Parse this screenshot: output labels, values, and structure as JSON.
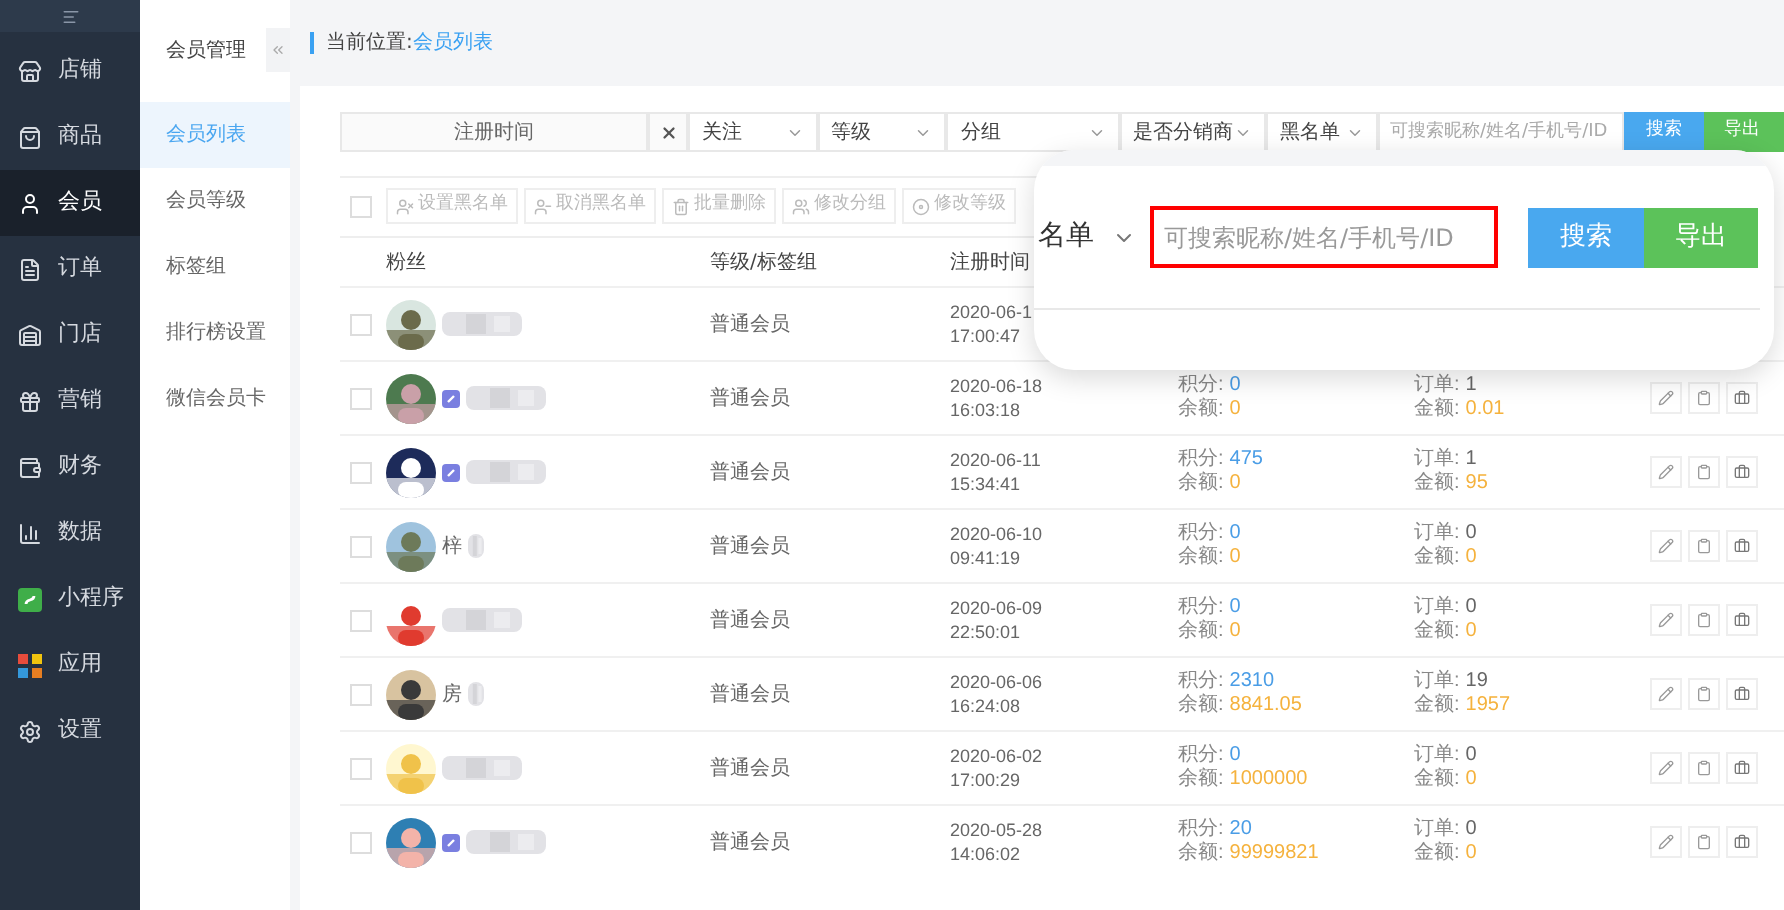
{
  "sidebar": {
    "items": [
      {
        "label": "店铺",
        "selected": false
      },
      {
        "label": "商品",
        "selected": false
      },
      {
        "label": "会员",
        "selected": true
      },
      {
        "label": "订单",
        "selected": false
      },
      {
        "label": "门店",
        "selected": false
      },
      {
        "label": "营销",
        "selected": false
      },
      {
        "label": "财务",
        "selected": false
      },
      {
        "label": "数据",
        "selected": false
      },
      {
        "label": "小程序",
        "selected": false
      },
      {
        "label": "应用",
        "selected": false
      },
      {
        "label": "设置",
        "selected": false
      }
    ]
  },
  "submenu": {
    "title": "会员管理",
    "items": [
      {
        "label": "会员列表",
        "selected": true
      },
      {
        "label": "会员等级",
        "selected": false
      },
      {
        "label": "标签组",
        "selected": false
      },
      {
        "label": "排行榜设置",
        "selected": false
      },
      {
        "label": "微信会员卡",
        "selected": false
      }
    ]
  },
  "breadcrumb": {
    "label": "当前位置:",
    "current": "会员列表"
  },
  "filters": [
    {
      "kind": "date",
      "placeholder": "注册时间"
    },
    {
      "kind": "clear"
    },
    {
      "kind": "select",
      "label": "关注"
    },
    {
      "kind": "select",
      "label": "等级"
    },
    {
      "kind": "select",
      "label": "分组"
    },
    {
      "kind": "select",
      "label": "是否分销商"
    },
    {
      "kind": "select",
      "label": "黑名单"
    },
    {
      "kind": "search",
      "placeholder": "可搜索昵称/姓名/手机号/ID"
    }
  ],
  "search_button": "搜索",
  "export_button": "导出",
  "select_all_checked": false,
  "bulk_actions": [
    "设置黑名单",
    "取消黑名单",
    "批量删除",
    "修改分组",
    "修改等级"
  ],
  "table": {
    "columns": [
      "粉丝",
      "等级/标签组",
      "注册时间"
    ],
    "rows": [
      {
        "checked": false,
        "linked": false,
        "blurred": true,
        "tier": "普通会员",
        "date": "2020-06-1",
        "time": "17:00:47"
      },
      {
        "checked": false,
        "linked": true,
        "blurred": true,
        "tier": "普通会员",
        "date": "2020-06-18",
        "time": "16:03:18",
        "points_label": "积分:",
        "points": "0",
        "balance_label": "余额:",
        "balance": "0",
        "orders_label": "订单:",
        "orders": "1",
        "amount_label": "金额:",
        "amount": "0.01"
      },
      {
        "checked": false,
        "linked": true,
        "blurred": true,
        "tier": "普通会员",
        "date": "2020-06-11",
        "time": "15:34:41",
        "points_label": "积分:",
        "points": "475",
        "balance_label": "余额:",
        "balance": "0",
        "orders_label": "订单:",
        "orders": "1",
        "amount_label": "金额:",
        "amount": "95"
      },
      {
        "checked": false,
        "linked": false,
        "name": "梓",
        "blurred": true,
        "tier": "普通会员",
        "date": "2020-06-10",
        "time": "09:41:19",
        "points_label": "积分:",
        "points": "0",
        "balance_label": "余额:",
        "balance": "0",
        "orders_label": "订单:",
        "orders": "0",
        "amount_label": "金额:",
        "amount": "0"
      },
      {
        "checked": false,
        "linked": false,
        "blurred": true,
        "tier": "普通会员",
        "date": "2020-06-09",
        "time": "22:50:01",
        "points_label": "积分:",
        "points": "0",
        "balance_label": "余额:",
        "balance": "0",
        "orders_label": "订单:",
        "orders": "0",
        "amount_label": "金额:",
        "amount": "0"
      },
      {
        "checked": false,
        "linked": false,
        "name": "房",
        "blurred": true,
        "tier": "普通会员",
        "date": "2020-06-06",
        "time": "16:24:08",
        "points_label": "积分:",
        "points": "2310",
        "balance_label": "余额:",
        "balance": "8841.05",
        "orders_label": "订单:",
        "orders": "19",
        "amount_label": "金额:",
        "amount": "1957"
      },
      {
        "checked": false,
        "linked": false,
        "blurred": true,
        "tier": "普通会员",
        "date": "2020-06-02",
        "time": "17:00:29",
        "points_label": "积分:",
        "points": "0",
        "balance_label": "余额:",
        "balance": "1000000",
        "orders_label": "订单:",
        "orders": "0",
        "amount_label": "金额:",
        "amount": "0"
      },
      {
        "checked": false,
        "linked": true,
        "blurred": true,
        "tier": "普通会员",
        "date": "2020-05-28",
        "time": "14:06:02",
        "points_label": "积分:",
        "points": "20",
        "balance_label": "余额:",
        "balance": "99999821",
        "orders_label": "订单:",
        "orders": "0",
        "amount_label": "金额:",
        "amount": "0"
      }
    ]
  },
  "zoom_callout": {
    "select_label": "名单",
    "placeholder": "可搜索昵称/姓名/手机号/ID",
    "search_button": "搜索",
    "export_button": "导出"
  }
}
